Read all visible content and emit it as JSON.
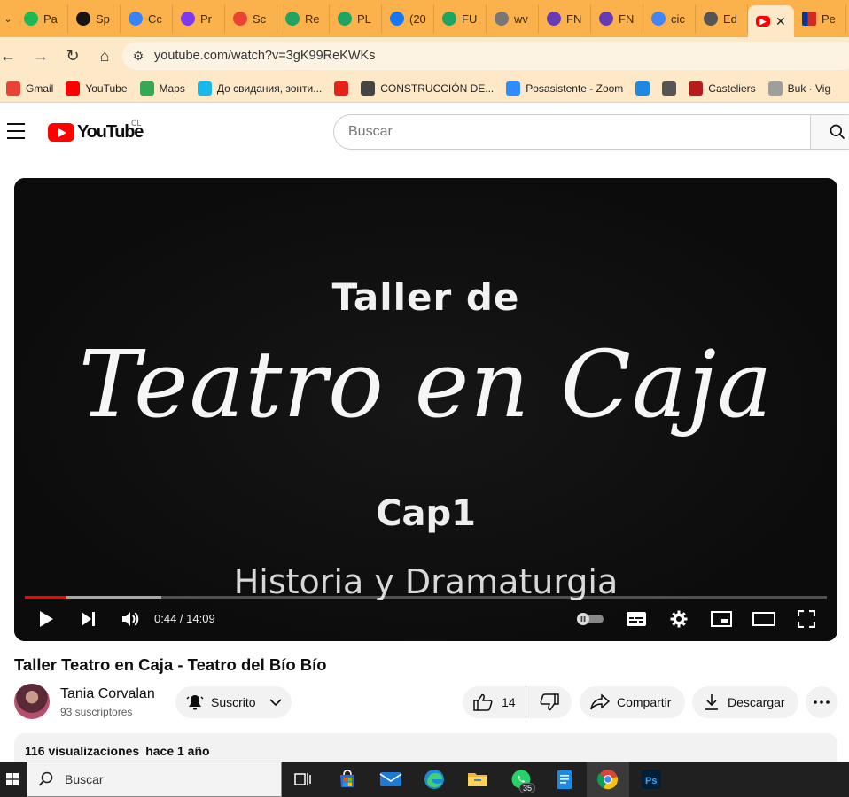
{
  "browser": {
    "tabs": [
      {
        "label": "Pa",
        "icon": "spotify-icon",
        "color": "#1db954"
      },
      {
        "label": "Sp",
        "icon": "spotify-icon",
        "color": "#191414"
      },
      {
        "label": "Cc",
        "icon": "canva-icon",
        "color": "#3b82f6"
      },
      {
        "label": "Pr",
        "icon": "shield-app-icon",
        "color": "#7c3aed"
      },
      {
        "label": "Sc",
        "icon": "gmail-icon",
        "color": "#ea4335"
      },
      {
        "label": "Re",
        "icon": "drive-icon",
        "color": "#1fa463"
      },
      {
        "label": "PL",
        "icon": "drive-icon",
        "color": "#1fa463"
      },
      {
        "label": "(20",
        "icon": "facebook-icon",
        "color": "#1877f2"
      },
      {
        "label": "FU",
        "icon": "drive-icon",
        "color": "#1fa463"
      },
      {
        "label": "wv",
        "icon": "globe-icon",
        "color": "#777777"
      },
      {
        "label": "FN",
        "icon": "forms-icon",
        "color": "#673ab7"
      },
      {
        "label": "FN",
        "icon": "forms-icon",
        "color": "#673ab7"
      },
      {
        "label": "cic",
        "icon": "google-icon",
        "color": "#4285f4"
      },
      {
        "label": "Ed",
        "icon": "document-icon",
        "color": "#555555"
      }
    ],
    "active_tab_icon": "youtube-icon",
    "last_tab": {
      "label": "Pe",
      "icon": "chile-flag-icon"
    },
    "address": "youtube.com/watch?v=3gK99ReKWKs",
    "bookmarks": [
      {
        "label": "Gmail",
        "icon": "gmail-icon",
        "color": "#ea4335"
      },
      {
        "label": "YouTube",
        "icon": "youtube-icon",
        "color": "#ff0000"
      },
      {
        "label": "Maps",
        "icon": "maps-icon",
        "color": "#34a853"
      },
      {
        "label": "До свидания, зонти...",
        "icon": "vimeo-icon",
        "color": "#1ab7ea"
      },
      {
        "label": "",
        "icon": "play-circle-icon",
        "color": "#e62117"
      },
      {
        "label": "CONSTRUCCIÓN DE...",
        "icon": "id-card-icon",
        "color": "#444444"
      },
      {
        "label": "Posasistente - Zoom",
        "icon": "zoom-icon",
        "color": "#2d8cff"
      },
      {
        "label": "",
        "icon": "p-app-icon",
        "color": "#1e88e5"
      },
      {
        "label": "",
        "icon": "book-icon",
        "color": "#555555"
      },
      {
        "label": "Casteliers",
        "icon": "hand-icon",
        "color": "#b71c1c"
      },
      {
        "label": "Buk · Vig",
        "icon": "buk-icon",
        "color": "#9e9e9e"
      }
    ]
  },
  "youtube": {
    "logo_text": "YouTube",
    "country": "CL",
    "search_placeholder": "Buscar"
  },
  "player": {
    "frame_text": {
      "line1": "Taller  de",
      "line2": "Teatro en Caja",
      "line3": "Cap1",
      "line4": "Historia y Dramaturgia"
    },
    "current_time": "0:44",
    "duration": "14:09",
    "time_display": "0:44 / 14:09",
    "progress_fraction": 0.052,
    "buffered_fraction": 0.17,
    "progress_color": "#ff0000"
  },
  "video": {
    "title": "Taller Teatro en Caja - Teatro del Bío Bío",
    "channel": "Tania Corvalan",
    "subscribers": "93 suscriptores",
    "subscribe_label": "Suscrito",
    "likes": "14",
    "share_label": "Compartir",
    "download_label": "Descargar",
    "views": "116 visualizaciones",
    "published": "hace 1 año"
  },
  "taskbar": {
    "search_placeholder": "Buscar",
    "whatsapp_badge": "35",
    "apps": [
      "task-view-icon",
      "store-icon",
      "mail-icon",
      "edge-icon",
      "file-explorer-icon",
      "whatsapp-icon",
      "notepad-icon",
      "chrome-icon",
      "photoshop-icon"
    ]
  }
}
